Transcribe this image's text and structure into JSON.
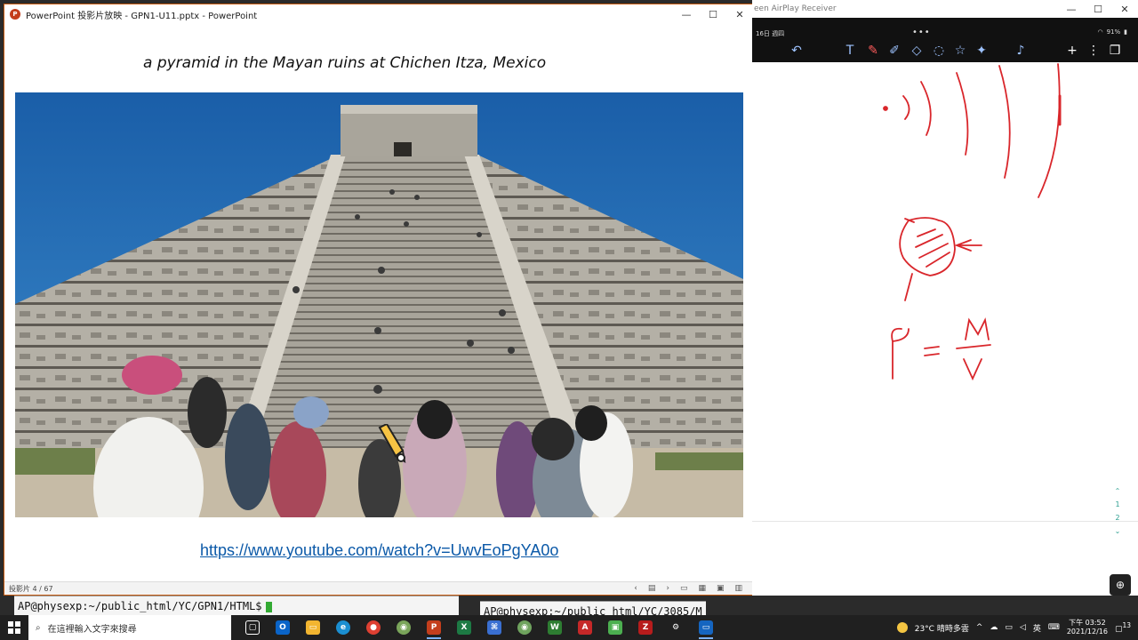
{
  "ppt": {
    "title": "PowerPoint 投影片放映  -  GPN1-U11.pptx - PowerPoint",
    "minimize": "—",
    "maximize": "☐",
    "close": "✕",
    "slide_title": "a pyramid in the Mayan ruins at Chichen Itza, Mexico",
    "slide_link": "https://www.youtube.com/watch?v=UwvEoPgYA0o",
    "status_left": "投影片 4 / 67"
  },
  "terminals": {
    "left": "AP@physexp:~/public_html/YC/GPN1/HTML$",
    "right": "AP@physexp:~/public_html/YC/3085/M"
  },
  "airplay": {
    "title": "een AirPlay Receiver",
    "date_small": "16日 週四",
    "battery": "91%",
    "dots": "•••",
    "page_numbers": [
      "1",
      "2"
    ],
    "formula_rho": "ρ",
    "formula_eq": "=",
    "formula_m": "M",
    "formula_v": "V"
  },
  "taskbar": {
    "search_placeholder": "在這裡輸入文字來搜尋",
    "weather": "23°C  晴時多雲",
    "lang": "英",
    "time": "下午 03:52",
    "date": "2021/12/16",
    "notif": "13"
  },
  "colors": {
    "accent_red": "#d9262b",
    "ppt_orange": "#c43e1c",
    "link_blue": "#0b59a8",
    "sky_blue": "#1e6ab0"
  }
}
